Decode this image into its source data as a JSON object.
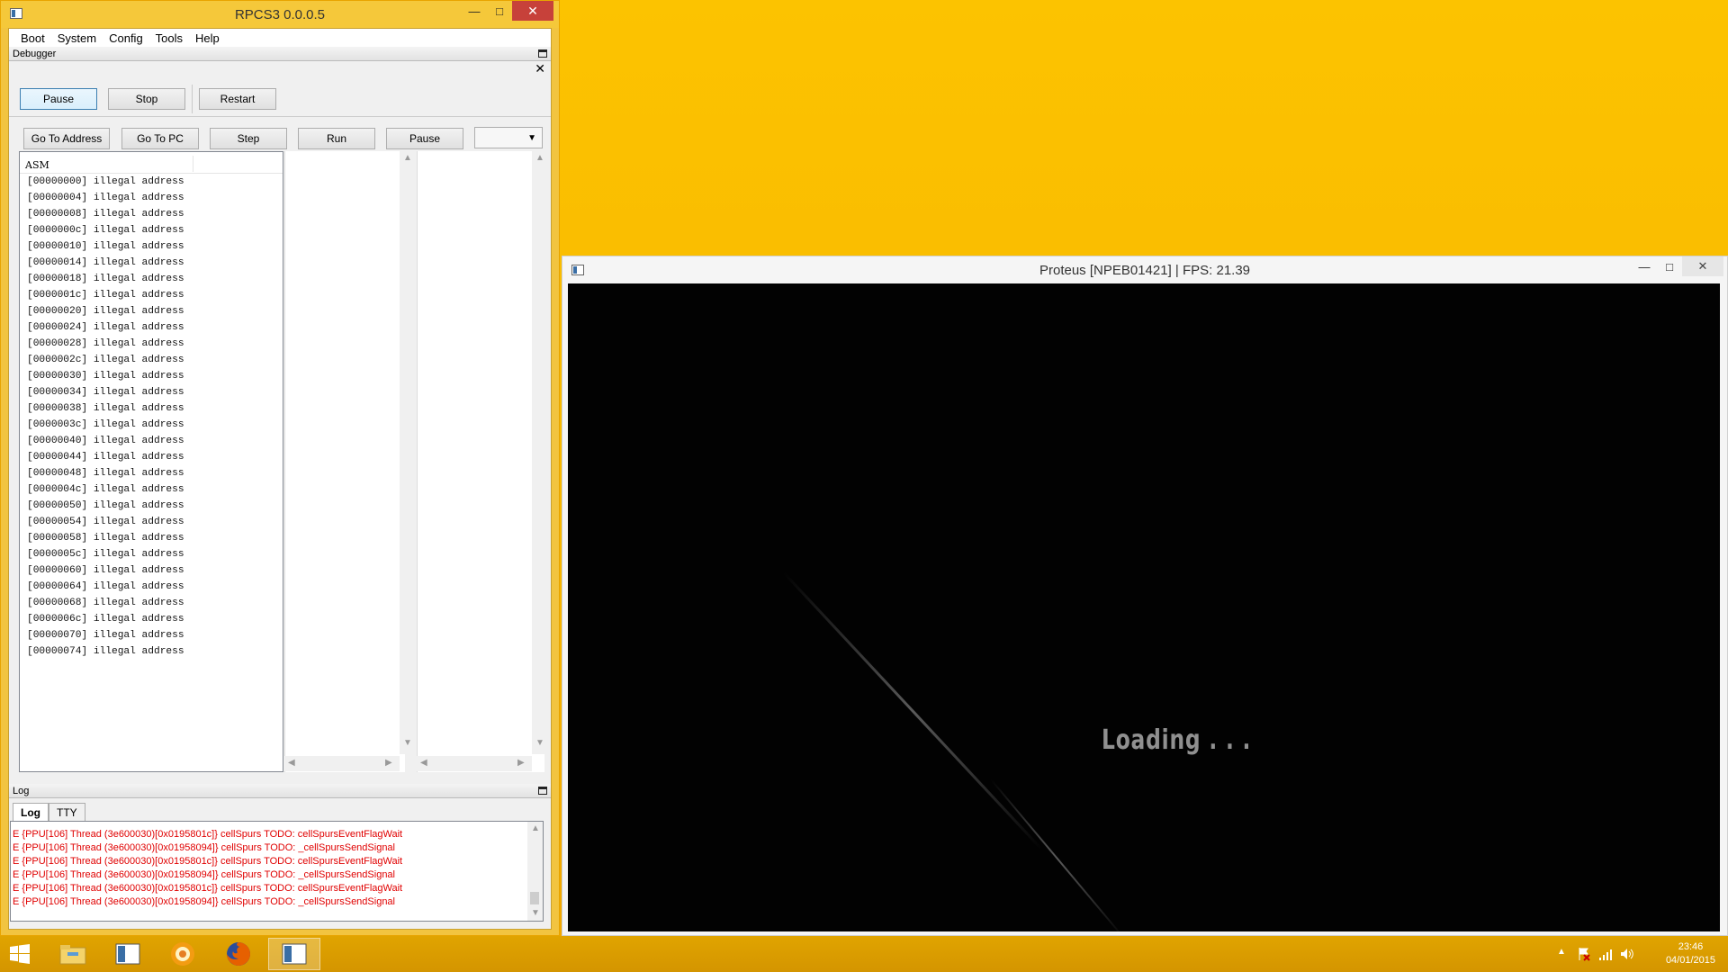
{
  "rpcs3": {
    "title": "RPCS3 0.0.0.5",
    "menu": [
      "Boot",
      "System",
      "Config",
      "Tools",
      "Help"
    ],
    "debugger_label": "Debugger",
    "controls": {
      "pause": "Pause",
      "stop": "Stop",
      "restart": "Restart"
    },
    "nav": {
      "goto_address": "Go To Address",
      "goto_pc": "Go To PC",
      "step": "Step",
      "run": "Run",
      "pause": "Pause",
      "dropdown_value": ""
    },
    "asm_header": "ASM",
    "asm_lines": [
      "[00000000] illegal address",
      "[00000004] illegal address",
      "[00000008] illegal address",
      "[0000000c] illegal address",
      "[00000010] illegal address",
      "[00000014] illegal address",
      "[00000018] illegal address",
      "[0000001c] illegal address",
      "[00000020] illegal address",
      "[00000024] illegal address",
      "[00000028] illegal address",
      "[0000002c] illegal address",
      "[00000030] illegal address",
      "[00000034] illegal address",
      "[00000038] illegal address",
      "[0000003c] illegal address",
      "[00000040] illegal address",
      "[00000044] illegal address",
      "[00000048] illegal address",
      "[0000004c] illegal address",
      "[00000050] illegal address",
      "[00000054] illegal address",
      "[00000058] illegal address",
      "[0000005c] illegal address",
      "[00000060] illegal address",
      "[00000064] illegal address",
      "[00000068] illegal address",
      "[0000006c] illegal address",
      "[00000070] illegal address",
      "[00000074] illegal address"
    ],
    "log_label": "Log",
    "log_tabs": [
      "Log",
      "TTY"
    ],
    "log_color": "#e00000",
    "log_lines": [
      "E {PPU[106] Thread (3e600030)[0x0195801c]} cellSpurs TODO: cellSpursEventFlagWait",
      "E {PPU[106] Thread (3e600030)[0x01958094]} cellSpurs TODO: _cellSpursSendSignal",
      "E {PPU[106] Thread (3e600030)[0x0195801c]} cellSpurs TODO: cellSpursEventFlagWait",
      "E {PPU[106] Thread (3e600030)[0x01958094]} cellSpurs TODO: _cellSpursSendSignal",
      "E {PPU[106] Thread (3e600030)[0x0195801c]} cellSpurs TODO: cellSpursEventFlagWait",
      "E {PPU[106] Thread (3e600030)[0x01958094]} cellSpurs TODO: _cellSpursSendSignal"
    ]
  },
  "game": {
    "title": "Proteus [NPEB01421] | FPS: 21.39",
    "loading_text": "Loading . . ."
  },
  "taskbar": {
    "time": "23:46",
    "date": "04/01/2015",
    "icons": [
      "start-icon",
      "file-explorer-icon",
      "rpcs3-icon",
      "media-player-icon",
      "firefox-icon",
      "rpcs3-game-icon"
    ]
  }
}
